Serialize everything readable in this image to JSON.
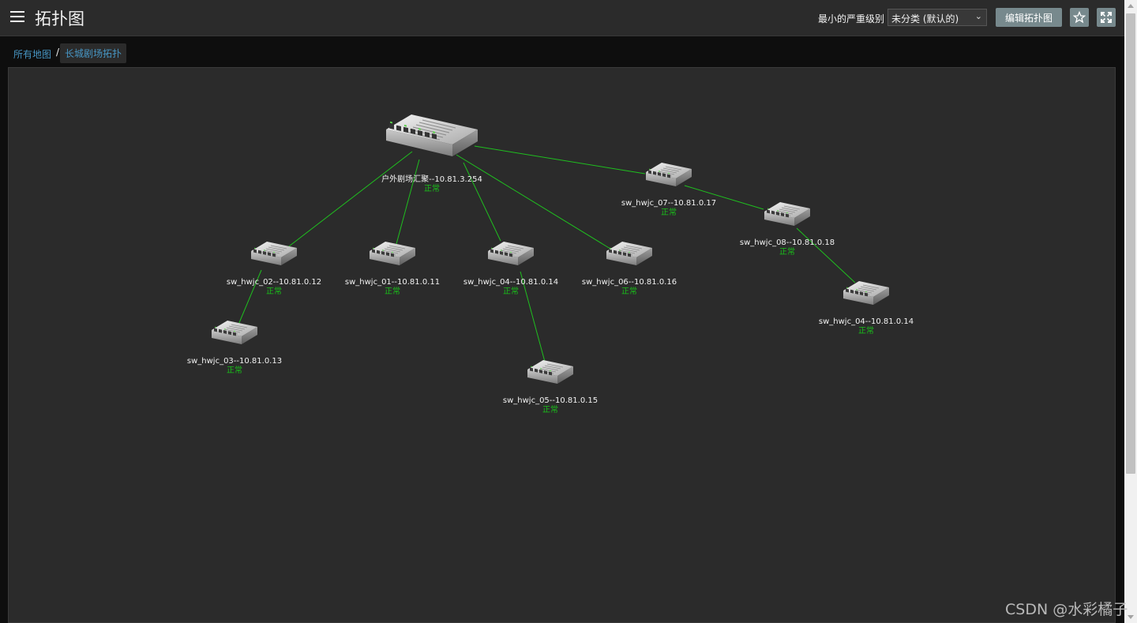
{
  "header": {
    "title": "拓扑图",
    "severity_label": "最小的严重级别",
    "severity_value": "未分类 (默认的)",
    "edit_button": "编辑拓扑图"
  },
  "breadcrumb": {
    "root": "所有地图",
    "separator": "/",
    "current": "长城剧场拓扑"
  },
  "topology": {
    "nodes": [
      {
        "id": "core",
        "label": "户外剧场汇聚--10.81.3.254",
        "status": "正常",
        "kind": "core-switch"
      },
      {
        "id": "n07",
        "label": "sw_hwjc_07--10.81.0.17",
        "status": "正常",
        "kind": "switch"
      },
      {
        "id": "n08",
        "label": "sw_hwjc_08--10.81.0.18",
        "status": "正常",
        "kind": "switch"
      },
      {
        "id": "n04b",
        "label": "sw_hwjc_04--10.81.0.14",
        "status": "正常",
        "kind": "switch"
      },
      {
        "id": "n02",
        "label": "sw_hwjc_02--10.81.0.12",
        "status": "正常",
        "kind": "switch"
      },
      {
        "id": "n01",
        "label": "sw_hwjc_01--10.81.0.11",
        "status": "正常",
        "kind": "switch"
      },
      {
        "id": "n04",
        "label": "sw_hwjc_04--10.81.0.14",
        "status": "正常",
        "kind": "switch"
      },
      {
        "id": "n06",
        "label": "sw_hwjc_06--10.81.0.16",
        "status": "正常",
        "kind": "switch"
      },
      {
        "id": "n03",
        "label": "sw_hwjc_03--10.81.0.13",
        "status": "正常",
        "kind": "switch"
      },
      {
        "id": "n05",
        "label": "sw_hwjc_05--10.81.0.15",
        "status": "正常",
        "kind": "switch"
      }
    ],
    "links": [
      [
        "core",
        "n07"
      ],
      [
        "n07",
        "n08"
      ],
      [
        "n08",
        "n04b"
      ],
      [
        "core",
        "n02"
      ],
      [
        "core",
        "n01"
      ],
      [
        "core",
        "n04"
      ],
      [
        "core",
        "n06"
      ],
      [
        "n02",
        "n03"
      ],
      [
        "n04",
        "n05"
      ]
    ]
  },
  "colors": {
    "link": "#1fbf1f",
    "status_ok": "#19c019",
    "accent_link": "#4796c4",
    "button": "#77898d"
  },
  "watermark": "CSDN @水彩橘子"
}
